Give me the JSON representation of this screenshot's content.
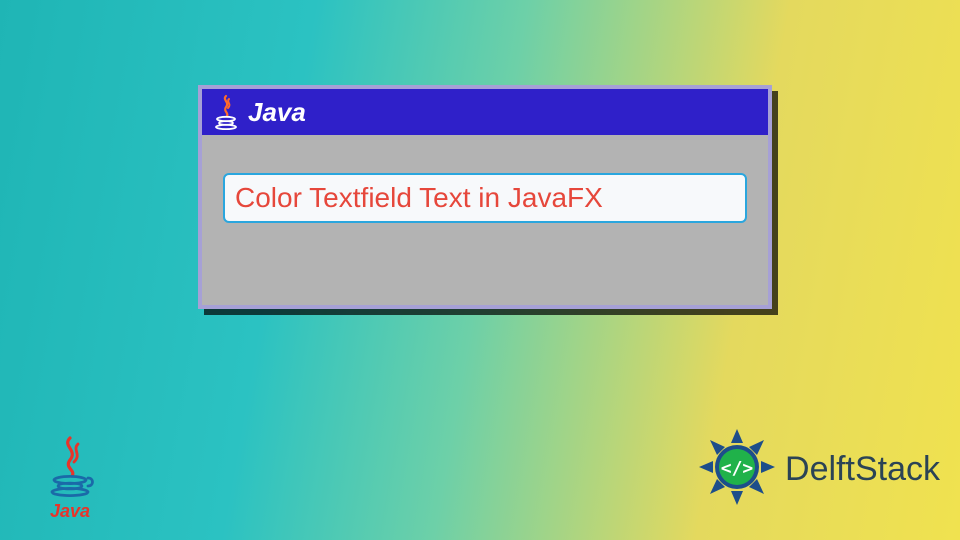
{
  "window": {
    "title": "Java",
    "titlebar_icon": "java-logo-icon"
  },
  "textfield": {
    "value": "Color Textfield Text in JavaFX",
    "text_color": "#e6473b",
    "border_color": "#2aa6de"
  },
  "footer": {
    "java_logo_label": "Java",
    "brand_label": "DelftStack"
  },
  "colors": {
    "titlebar_bg": "#2f20c9",
    "window_bg": "#b3b3b3",
    "window_border": "#a6a0d6"
  }
}
